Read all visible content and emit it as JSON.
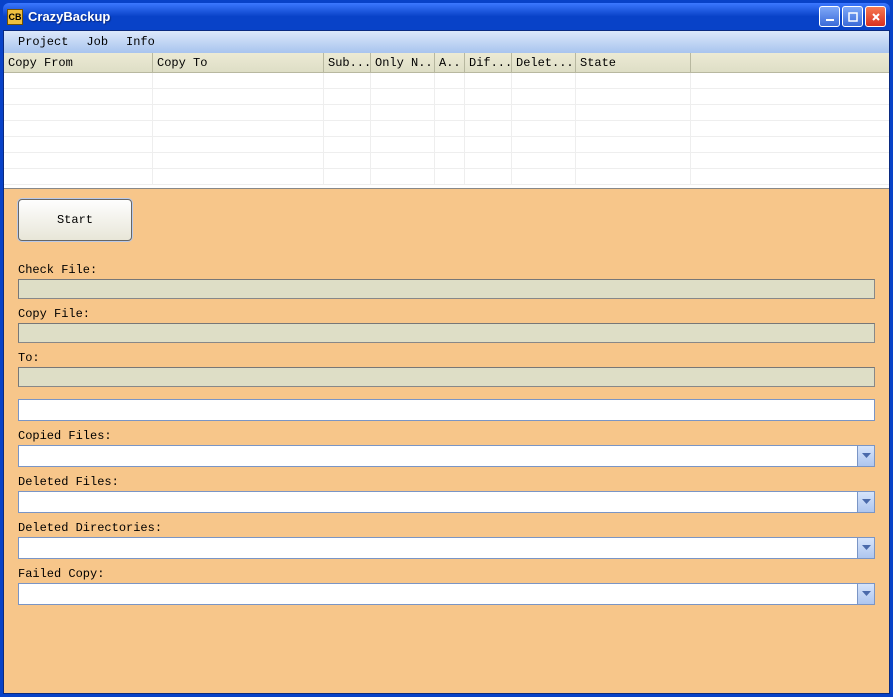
{
  "window": {
    "title": "CrazyBackup",
    "icon_text": "CB"
  },
  "menu": {
    "project": "Project",
    "job": "Job",
    "info": "Info"
  },
  "grid": {
    "headers": {
      "copy_from": "Copy From",
      "copy_to": "Copy To",
      "sub": "Sub...",
      "only_n": "Only N...",
      "a": "A..",
      "dif": "Dif...",
      "delet": "Delet...",
      "state": "State"
    }
  },
  "form": {
    "start_button": "Start",
    "check_file_label": "Check File:",
    "copy_file_label": "Copy File:",
    "to_label": "To:",
    "copied_files_label": "Copied Files:",
    "deleted_files_label": "Deleted Files:",
    "deleted_directories_label": "Deleted Directories:",
    "failed_copy_label": "Failed Copy:"
  },
  "col_widths": {
    "copy_from": 149,
    "copy_to": 171,
    "sub": 47,
    "only_n": 64,
    "a": 30,
    "dif": 47,
    "delet": 64,
    "state": 115,
    "tail": 190
  }
}
